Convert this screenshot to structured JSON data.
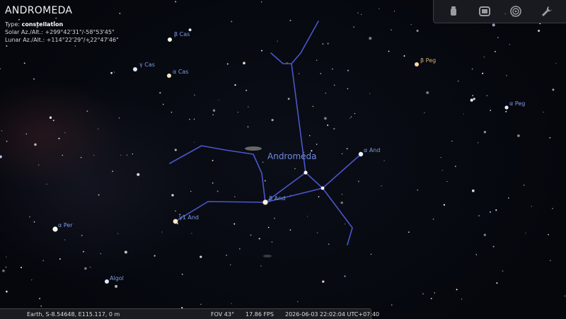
{
  "selected_object": {
    "name": "ANDROMEDA",
    "type_label": "Type:",
    "type_value": "constellation",
    "solar": "Solar Az./Alt.: +299°42'31\"/-58°53'45\"",
    "lunar": "Lunar Az./Alt.: +114°22'29\"/+22°47'46\""
  },
  "constellation_label": "Andromeda",
  "star_labels": {
    "beta_cas": "β Cas",
    "gamma_cas": "γ Cas",
    "alpha_cas": "α Cas",
    "beta_peg": "β Peg",
    "alpha_peg": "α Peg",
    "alpha_and": "α And",
    "beta_and": "β And",
    "gamma1_and": "γ1 And",
    "alpha_per": "α Per",
    "algol": "Algol"
  },
  "toolbar": {
    "buttons": [
      "observatory-icon",
      "screen-icon",
      "target-icon",
      "wrench-icon"
    ]
  },
  "status_bar": {
    "location": "Earth, S-8.54648, E115.117, 0 m",
    "fov": "FOV 43°",
    "fps": "17.86 FPS",
    "datetime": "2026-06-03 22:02:04 UTC+07:40"
  },
  "colors": {
    "constellation_line": "#4b57c9",
    "label_blue": "#7f9ce6",
    "label_gold": "#d8b070"
  }
}
